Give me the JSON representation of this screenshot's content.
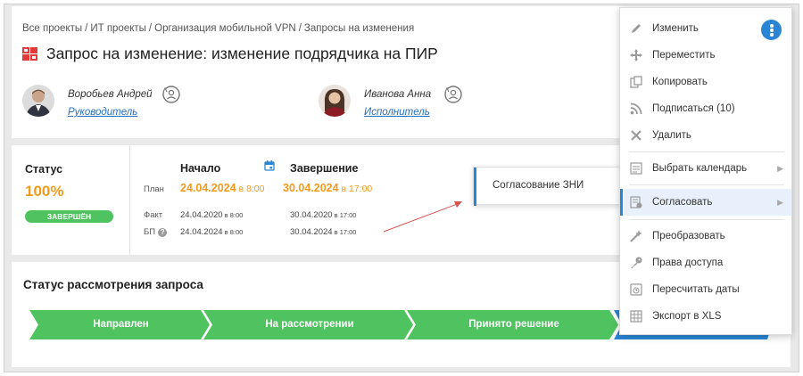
{
  "breadcrumb": [
    "Все проекты",
    "ИТ проекты",
    "Организация мобильной VPN",
    "Запросы на изменения"
  ],
  "breadcrumb_separator": "/",
  "page_title": "Запрос на изменение: изменение подрядчика на ПИР",
  "people": [
    {
      "name": "Воробьев Андрей",
      "role": "Руководитель"
    },
    {
      "name": "Иванова Анна",
      "role": "Исполнитель"
    }
  ],
  "status": {
    "label": "Статус",
    "percent": "100%",
    "badge": "ЗАВЕРШЁН",
    "badge_color": "#4fc35f",
    "percent_color": "#f39a1e"
  },
  "dates": {
    "start_header": "Начало",
    "end_header": "Завершение",
    "plan_label": "План",
    "fact_label": "Факт",
    "bp_label": "БП",
    "plan_start_date": "24.04.2024",
    "plan_start_time": " в 8:00",
    "plan_end_date": "30.04.2024",
    "plan_end_time": " в 17:00",
    "fact_start_date": "24.04.2020",
    "fact_start_time": " в 8:00",
    "fact_end_date": "30.04.2020",
    "fact_end_time": " в 17:00",
    "bp_start_date": "24.04.2024",
    "bp_start_time": " в 8:00",
    "bp_end_date": "30.04.2024",
    "bp_end_time": " в 17:00"
  },
  "submenu": {
    "item": "Согласование ЗНИ"
  },
  "review": {
    "title": "Статус рассмотрения запроса",
    "stages": [
      "Направлен",
      "На рассмотрении",
      "Принято решение"
    ],
    "stage_color": "#4fc35f",
    "current_color": "#2a86d5"
  },
  "menu": {
    "items": [
      {
        "label": "Изменить",
        "icon": "pencil-icon"
      },
      {
        "label": "Переместить",
        "icon": "move-icon"
      },
      {
        "label": "Копировать",
        "icon": "copy-icon"
      },
      {
        "label": "Подписаться (10)",
        "icon": "rss-icon"
      },
      {
        "label": "Удалить",
        "icon": "close-icon"
      },
      {
        "label": "Выбрать календарь",
        "icon": "calendar-list-icon",
        "has_submenu": true
      },
      {
        "label": "Согласовать",
        "icon": "approve-doc-icon",
        "has_submenu": true,
        "active": true
      },
      {
        "label": "Преобразовать",
        "icon": "magic-wand-icon"
      },
      {
        "label": "Права доступа",
        "icon": "key-icon"
      },
      {
        "label": "Пересчитать даты",
        "icon": "recalc-icon"
      },
      {
        "label": "Экспорт в XLS",
        "icon": "table-icon"
      }
    ],
    "submenu_arrow": "▶",
    "accent": "#2a86d5"
  }
}
